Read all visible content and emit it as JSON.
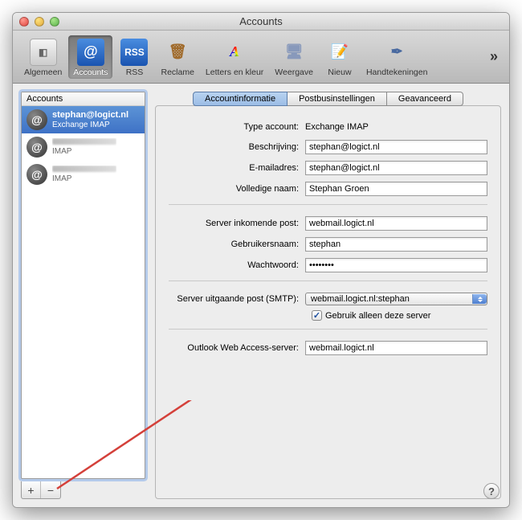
{
  "window": {
    "title": "Accounts"
  },
  "toolbar": {
    "items": [
      {
        "label": "Algemeen",
        "icon": "switch-icon"
      },
      {
        "label": "Accounts",
        "icon": "at-icon",
        "selected": true
      },
      {
        "label": "RSS",
        "icon": "rss-icon"
      },
      {
        "label": "Reclame",
        "icon": "junk-icon"
      },
      {
        "label": "Letters en kleur",
        "icon": "fonts-icon"
      },
      {
        "label": "Weergave",
        "icon": "viewing-icon"
      },
      {
        "label": "Nieuw",
        "icon": "composing-icon"
      },
      {
        "label": "Handtekeningen",
        "icon": "signature-icon"
      }
    ],
    "overflow": "»"
  },
  "sidebar": {
    "header": "Accounts",
    "accounts": [
      {
        "name": "stephan@logict.nl",
        "type": "Exchange IMAP",
        "selected": true
      },
      {
        "name": "",
        "type": "IMAP",
        "redacted": true
      },
      {
        "name": "",
        "type": "IMAP",
        "redacted": true
      }
    ],
    "add": "+",
    "remove": "−"
  },
  "tabs": {
    "info": "Accountinformatie",
    "mailbox": "Postbusinstellingen",
    "advanced": "Geavanceerd",
    "active": "info"
  },
  "form": {
    "type_label": "Type account:",
    "type_value": "Exchange IMAP",
    "desc_label": "Beschrijving:",
    "desc_value": "stephan@logict.nl",
    "email_label": "E-mailadres:",
    "email_value": "stephan@logict.nl",
    "fullname_label": "Volledige naam:",
    "fullname_value": "Stephan Groen",
    "incoming_label": "Server inkomende post:",
    "incoming_value": "webmail.logict.nl",
    "user_label": "Gebruikersnaam:",
    "user_value": "stephan",
    "pass_label": "Wachtwoord:",
    "pass_value": "••••••••",
    "smtp_label": "Server uitgaande post (SMTP):",
    "smtp_value": "webmail.logict.nl:stephan",
    "only_this_server_label": "Gebruik alleen deze server",
    "only_this_server_checked": true,
    "owa_label": "Outlook Web Access-server:",
    "owa_value": "webmail.logict.nl"
  },
  "help": "?"
}
